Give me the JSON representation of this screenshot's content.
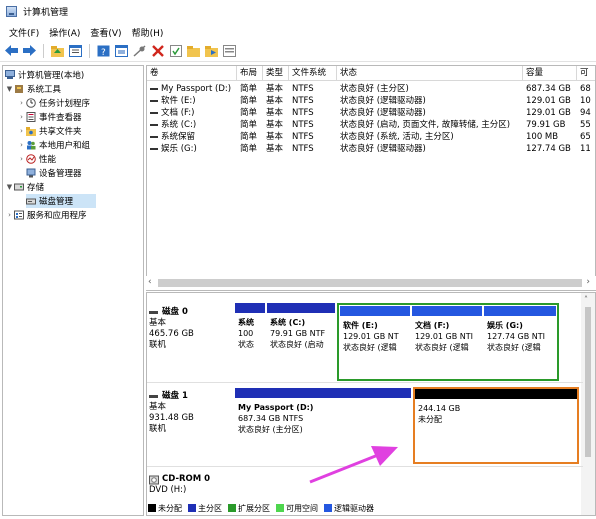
{
  "window": {
    "title": "计算机管理"
  },
  "menu": [
    "文件(F)",
    "操作(A)",
    "查看(V)",
    "帮助(H)"
  ],
  "toolbar": {
    "icons": [
      "back-icon",
      "forward-icon",
      "up-icon",
      "show-tree-icon",
      "help-icon",
      "properties-icon",
      "connect-icon",
      "delete-icon",
      "check-icon",
      "folder-icon",
      "export-icon",
      "view-icon"
    ]
  },
  "tree": {
    "root": "计算机管理(本地)",
    "system_tools": "系统工具",
    "task_scheduler": "任务计划程序",
    "event_viewer": "事件查看器",
    "shared_folders": "共享文件夹",
    "local_users": "本地用户和组",
    "performance": "性能",
    "device_manager": "设备管理器",
    "storage": "存储",
    "disk_management": "磁盘管理",
    "services": "服务和应用程序"
  },
  "volumes": {
    "headers": [
      "卷",
      "布局",
      "类型",
      "文件系统",
      "状态",
      "容量",
      "可"
    ],
    "rows": [
      [
        "My Passport (D:)",
        "简单",
        "基本",
        "NTFS",
        "状态良好 (主分区)",
        "687.34 GB",
        "68"
      ],
      [
        "软件 (E:)",
        "简单",
        "基本",
        "NTFS",
        "状态良好 (逻辑驱动器)",
        "129.01 GB",
        "10"
      ],
      [
        "文档 (F:)",
        "简单",
        "基本",
        "NTFS",
        "状态良好 (逻辑驱动器)",
        "129.01 GB",
        "94"
      ],
      [
        "系统 (C:)",
        "简单",
        "基本",
        "NTFS",
        "状态良好 (启动, 页面文件, 故障转储, 主分区)",
        "79.91 GB",
        "55"
      ],
      [
        "系统保留",
        "简单",
        "基本",
        "NTFS",
        "状态良好 (系统, 活动, 主分区)",
        "100 MB",
        "65"
      ],
      [
        "娱乐 (G:)",
        "简单",
        "基本",
        "NTFS",
        "状态良好 (逻辑驱动器)",
        "127.74 GB",
        "11"
      ]
    ]
  },
  "disks": [
    {
      "name": "磁盘 0",
      "type": "基本",
      "size": "465.76 GB",
      "status": "联机",
      "parts": [
        {
          "title": "系统",
          "line2": "100",
          "line3": "状态"
        },
        {
          "title": "系统 (C:)",
          "line2": "79.91 GB NTF",
          "line3": "状态良好 (启动"
        },
        {
          "title": "软件 (E:)",
          "line2": "129.01 GB NT",
          "line3": "状态良好 (逻辑"
        },
        {
          "title": "文档 (F:)",
          "line2": "129.01 GB NTI",
          "line3": "状态良好 (逻辑"
        },
        {
          "title": "娱乐 (G:)",
          "line2": "127.74 GB NTI",
          "line3": "状态良好 (逻辑"
        }
      ]
    },
    {
      "name": "磁盘 1",
      "type": "基本",
      "size": "931.48 GB",
      "status": "联机",
      "parts": [
        {
          "title": "My Passport (D:)",
          "line2": "687.34 GB NTFS",
          "line3": "状态良好 (主分区)"
        },
        {
          "title": "",
          "line2": "244.14 GB",
          "line3": "未分配"
        }
      ]
    },
    {
      "name": "CD-ROM 0",
      "type": "DVD (H:)"
    }
  ],
  "legend": [
    {
      "label": "未分配",
      "color": "#000000"
    },
    {
      "label": "主分区",
      "color": "#1f2fb5"
    },
    {
      "label": "扩展分区",
      "color": "#2a9a2a"
    },
    {
      "label": "可用空间",
      "color": "#4ed64e"
    },
    {
      "label": "逻辑驱动器",
      "color": "#2457e0"
    }
  ],
  "colors": {
    "primary": "#1f2fb5",
    "logical": "#2457e0",
    "extended": "#2a9a2a",
    "unallocated": "#000000",
    "highlight": "#e67e22",
    "arrow": "#e040e0"
  }
}
